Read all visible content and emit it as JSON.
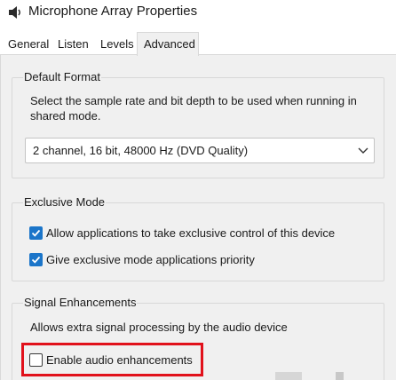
{
  "window": {
    "title": "Microphone Array Properties",
    "icon": "speaker-icon"
  },
  "tabs": [
    {
      "label": "General",
      "selected": false
    },
    {
      "label": "Listen",
      "selected": false
    },
    {
      "label": "Levels",
      "selected": false
    },
    {
      "label": "Advanced",
      "selected": true
    }
  ],
  "default_format": {
    "title": "Default Format",
    "description_line1": "Select the sample rate and bit depth to be used when running in",
    "description_line2": "shared mode.",
    "selected_value": "2 channel, 16 bit, 48000 Hz (DVD Quality)"
  },
  "exclusive_mode": {
    "title": "Exclusive Mode",
    "options": [
      {
        "label": "Allow applications to take exclusive control of this device",
        "checked": true
      },
      {
        "label": "Give exclusive mode applications priority",
        "checked": true
      }
    ]
  },
  "signal_enhancements": {
    "title": "Signal Enhancements",
    "description": "Allows extra signal processing by the audio device",
    "enable_label": "Enable audio enhancements",
    "enable_checked": false
  },
  "colors": {
    "accent": "#1b75c9",
    "highlight": "#e1111b"
  }
}
